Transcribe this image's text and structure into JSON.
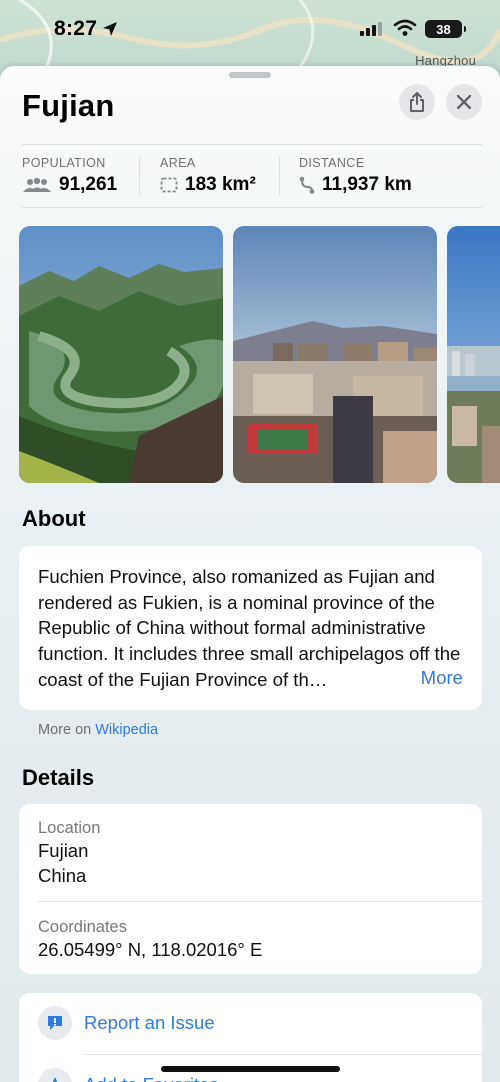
{
  "status_bar": {
    "time": "8:27",
    "battery": "38"
  },
  "map": {
    "city_label": "Hangzhou"
  },
  "sheet": {
    "title": "Fujian",
    "stats": [
      {
        "label": "POPULATION",
        "value": "91,261",
        "icon": "people-icon"
      },
      {
        "label": "AREA",
        "value": "183 km²",
        "icon": "area-icon"
      },
      {
        "label": "DISTANCE",
        "value": "11,937 km",
        "icon": "route-icon"
      }
    ],
    "photos": [
      {
        "name": "river-valley-photo"
      },
      {
        "name": "city-skyline-photo"
      },
      {
        "name": "waterfront-city-photo"
      }
    ],
    "about": {
      "heading": "About",
      "text": "Fuchien Province, also romanized as Fujian and rendered as Fukien, is a nominal province of the Republic of China without formal administrative function. It includes three small archipelagos off the coast of the Fujian Province of th…",
      "more": "More",
      "source_prefix": "More on",
      "source_link": "Wikipedia"
    },
    "details": {
      "heading": "Details",
      "location_label": "Location",
      "location_line1": "Fujian",
      "location_line2": "China",
      "coordinates_label": "Coordinates",
      "coordinates": "26.05499° N, 118.02016° E"
    },
    "actions": [
      {
        "label": "Report an Issue",
        "icon": "report-issue-icon"
      },
      {
        "label": "Add to Favorites",
        "icon": "add-favorite-icon"
      }
    ]
  },
  "colors": {
    "accent": "#2f7be0",
    "secondary_text": "#6d6f72"
  }
}
